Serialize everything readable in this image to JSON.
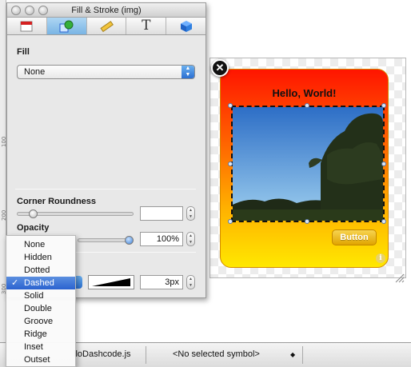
{
  "ruler": {
    "ticks": [
      "100",
      "200",
      "300"
    ]
  },
  "inspector": {
    "title": "Fill & Stroke (img)",
    "toolbar_icons": [
      "calendar-icon",
      "fill-stroke-icon",
      "ruler-icon",
      "text-icon",
      "cube-icon"
    ],
    "fill": {
      "label": "Fill",
      "value": "None"
    },
    "corner": {
      "label": "Corner Roundness",
      "value": ""
    },
    "opacity": {
      "label": "Opacity",
      "value": "100%",
      "level": 1.0
    },
    "stroke": {
      "width": "3px"
    }
  },
  "stroke_menu": {
    "items": [
      "None",
      "Hidden",
      "Dotted",
      "Dashed",
      "Solid",
      "Double",
      "Groove",
      "Ridge",
      "Inset",
      "Outset"
    ],
    "selected": "Dashed"
  },
  "widget": {
    "title": "Hello, World!",
    "button_label": "Button"
  },
  "bottombar": {
    "file": "lloDashcode.js",
    "symbol": "<No selected symbol>"
  },
  "colors": {
    "accent": "#2a62cf",
    "widget_top": "#ff1500",
    "widget_bottom": "#ffe800"
  }
}
